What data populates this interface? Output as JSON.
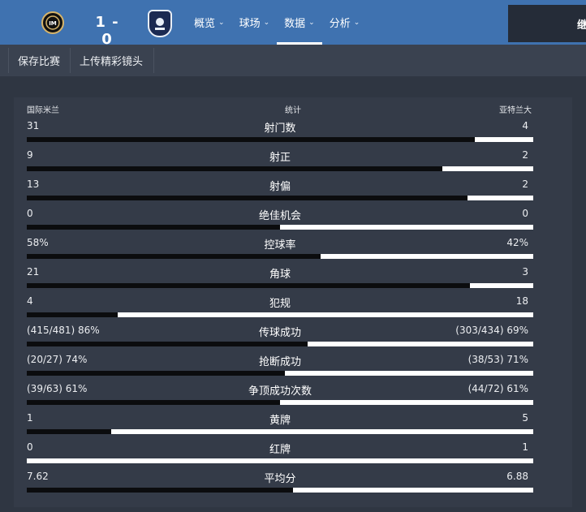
{
  "header": {
    "home_logo_icon": "inter-crest-icon",
    "away_logo_icon": "atalanta-crest-icon",
    "score": "1 - 0",
    "nav": [
      {
        "label": "概览",
        "active": false
      },
      {
        "label": "球场",
        "active": false
      },
      {
        "label": "数据",
        "active": true
      },
      {
        "label": "分析",
        "active": false
      }
    ],
    "right_partial": "继"
  },
  "toolbar": {
    "save_label": "保存比赛",
    "upload_label": "上传精彩镜头"
  },
  "stats_header": {
    "home": "国际米兰",
    "title": "统计",
    "away": "亚特兰大"
  },
  "stats": [
    {
      "home": "31",
      "label": "射门数",
      "away": "4",
      "home_share": 0.885
    },
    {
      "home": "9",
      "label": "射正",
      "away": "2",
      "home_share": 0.82
    },
    {
      "home": "13",
      "label": "射偏",
      "away": "2",
      "home_share": 0.87
    },
    {
      "home": "0",
      "label": "绝佳机会",
      "away": "0",
      "home_share": 0.5
    },
    {
      "home": "58%",
      "label": "控球率",
      "away": "42%",
      "home_share": 0.58
    },
    {
      "home": "21",
      "label": "角球",
      "away": "3",
      "home_share": 0.875
    },
    {
      "home": "4",
      "label": "犯规",
      "away": "18",
      "home_share": 0.18
    },
    {
      "home": "(415/481) 86%",
      "label": "传球成功",
      "away": "(303/434) 69%",
      "home_share": 0.555
    },
    {
      "home": "(20/27) 74%",
      "label": "抢断成功",
      "away": "(38/53) 71%",
      "home_share": 0.51
    },
    {
      "home": "(39/63) 61%",
      "label": "争顶成功次数",
      "away": "(44/72) 61%",
      "home_share": 0.5
    },
    {
      "home": "1",
      "label": "黄牌",
      "away": "5",
      "home_share": 0.167
    },
    {
      "home": "0",
      "label": "红牌",
      "away": "1",
      "home_share": 0.0
    },
    {
      "home": "7.62",
      "label": "平均分",
      "away": "6.88",
      "home_share": 0.525
    }
  ],
  "colors": {
    "topbar": "#3f72b0",
    "background": "#2f3642",
    "home_bar": "#0b0c0e",
    "away_bar": "#ffffff"
  }
}
